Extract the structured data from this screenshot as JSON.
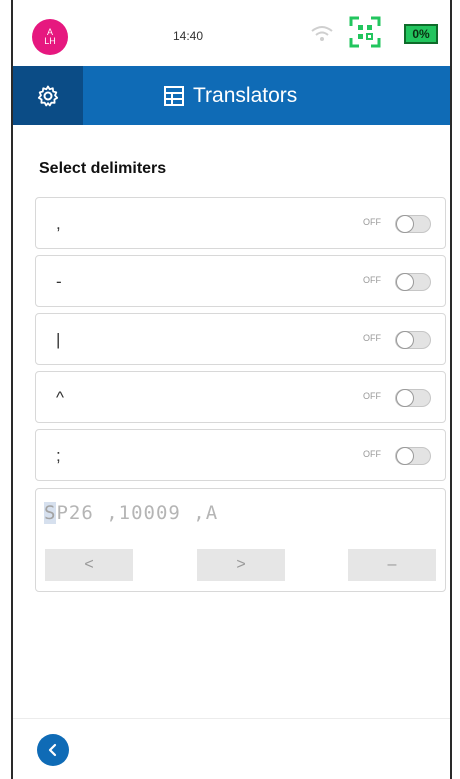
{
  "status_bar": {
    "avatar_top": "A",
    "avatar_bottom": "LH",
    "time": "14:40",
    "battery": "0%"
  },
  "header": {
    "title": "Translators"
  },
  "section_title": "Select delimiters",
  "delimiters": [
    {
      "symbol": ",",
      "state": "OFF"
    },
    {
      "symbol": "-",
      "state": "OFF"
    },
    {
      "symbol": "|",
      "state": "OFF"
    },
    {
      "symbol": "^",
      "state": "OFF"
    },
    {
      "symbol": ";",
      "state": "OFF"
    }
  ],
  "preview": {
    "cursor_char": "S",
    "text_rest": "P26 ,10009 ,A",
    "prev_label": "<",
    "next_label": ">",
    "remove_label": "–"
  },
  "colors": {
    "primary": "#0f6bb6",
    "primary_dark": "#0b4c86",
    "avatar": "#e6187f",
    "battery": "#22c55e"
  }
}
